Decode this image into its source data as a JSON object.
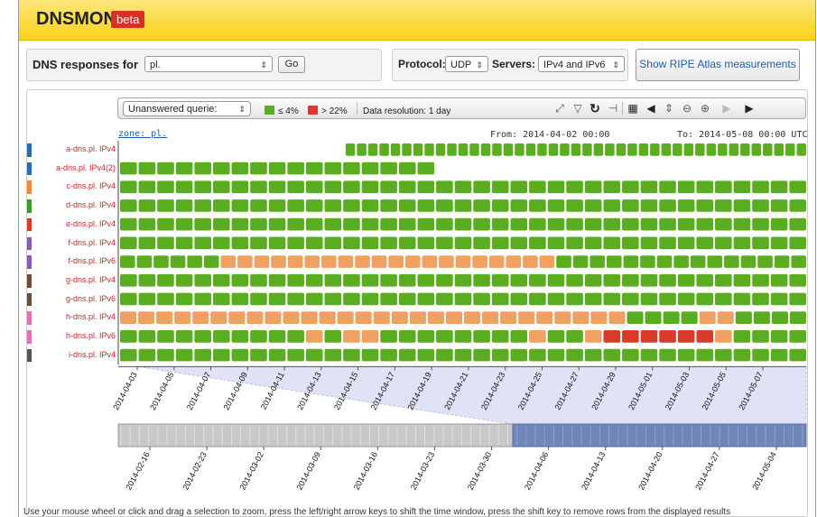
{
  "header": {
    "brand": "DNSMON",
    "badge": "beta"
  },
  "query": {
    "label": "DNS responses for",
    "zone_value": "pl.",
    "go": "Go",
    "protocol_label": "Protocol:",
    "protocol_value": "UDP",
    "servers_label": "Servers:",
    "servers_value": "IPv4 and IPv6",
    "atlas_link": "Show RIPE Atlas measurements"
  },
  "toolbar": {
    "metric_value": "Unanswered querie:",
    "legend_low": "≤ 4%",
    "legend_high": "> 22%",
    "resolution": "Data resolution: 1 day",
    "icons": [
      "fullscreen-icon",
      "filter-icon",
      "refresh-icon",
      "pin-icon",
      "calendar-icon",
      "prev-icon",
      "zoom-slider-icon",
      "zoom-out-icon",
      "zoom-in-icon",
      "next-icon",
      "last-icon"
    ]
  },
  "chart_data": {
    "type": "heatmap",
    "title": "zone: pl.",
    "from_label": "From: 2014-04-02 00:00",
    "to_label": "To: 2014-05-08 00:00 UTC",
    "colors": {
      "low": "#5aad1e",
      "mid": "#f0a060",
      "high": "#d93a2a",
      "empty": "#ffffff"
    },
    "legend": [
      {
        "label": "≤ 4%",
        "color": "#5aad1e"
      },
      {
        "label": "> 22%",
        "color": "#d93a2a"
      }
    ],
    "x_ticks": [
      "2014-04-03",
      "2014-04-05",
      "2014-04-07",
      "2014-04-09",
      "2014-04-11",
      "2014-04-13",
      "2014-04-15",
      "2014-04-17",
      "2014-04-19",
      "2014-04-21",
      "2014-04-23",
      "2014-04-25",
      "2014-04-27",
      "2014-04-29",
      "2014-05-01",
      "2014-05-03",
      "2014-05-05",
      "2014-05-07"
    ],
    "overview_ticks": [
      "2014-02-16",
      "2014-02-23",
      "2014-03-02",
      "2014-03-09",
      "2014-03-16",
      "2014-03-23",
      "2014-03-30",
      "2014-04-06",
      "2014-04-13",
      "2014-04-20",
      "2014-04-27",
      "2014-05-04"
    ],
    "rows": [
      {
        "name": "a-dns.pl. IPv4",
        "group_color": "#2e6da4",
        "cells": "____________________GGGGGGGGGGGGGGGGGGGGGGGGGGGGGGGGGGGGGGGGG"
      },
      {
        "name": "a-dns.pl. IPv4(2)",
        "group_color": "#2e6da4",
        "cells": "GGGGGGGGGGGGGGGGG"
      },
      {
        "name": "c-dns.pl. IPv4",
        "group_color": "#f08a3c",
        "cells": "GGGGGGGGGGGGGGGGGGGGGGGGGGGGGGGGGGGGG"
      },
      {
        "name": "d-dns.pl. IPv4",
        "group_color": "#3a9a2a",
        "cells": "GGGGGGGGGGGGGGGGGGGGGGGGGGGGGGGGGGGGG"
      },
      {
        "name": "e-dns.pl. IPv4",
        "group_color": "#d93a2a",
        "cells": "GGGGGGGGGGGGGGGGGGGGGGGGGGGGGGGGGGGGG"
      },
      {
        "name": "f-dns.pl. IPv4",
        "group_color": "#8a5ab0",
        "cells": "GGGGGGGGGGGGGGGGGGGGGGGGGGGGGGGGGGGGG"
      },
      {
        "name": "f-dns.pl. IPv6",
        "group_color": "#8a5ab0",
        "cells": "GGGGGGOOOOOOOOOOOOOOOOOOOOGGGGGGGGGGGGGGG"
      },
      {
        "name": "g-dns.pl. IPv4",
        "group_color": "#6e4a3a",
        "cells": "GGGGGGGGGGGGGGGGGGGGGGGGGGGGGGGGGGGGG"
      },
      {
        "name": "g-dns.pl. IPv6",
        "group_color": "#6e4a3a",
        "cells": "GGGGGGGGGGGGGGGGGGGGGGGGGGGGGGGGGGGGG"
      },
      {
        "name": "h-dns.pl. IPv4",
        "group_color": "#e070c0",
        "cells": "OOOOOOOOOOOOOOOOOOOOOOOOOOOOGGGGOOGGGG"
      },
      {
        "name": "h-dns.pl. IPv6",
        "group_color": "#e070c0",
        "cells": "GGGGGGGGGGOGOOGGGGGGGGOGGORRRRRROGGGG"
      },
      {
        "name": "i-dns.pl. IPv4",
        "group_color": "#555555",
        "cells": "GGGGGGGGGGGGGGGGGGGGGGGGGGGGGGGGGGGGG"
      }
    ]
  },
  "footer": {
    "help": "Use your mouse wheel or click and drag a selection to zoom, press the left/right arrow keys to shift the time window, press the shift key to remove rows from the displayed results"
  }
}
